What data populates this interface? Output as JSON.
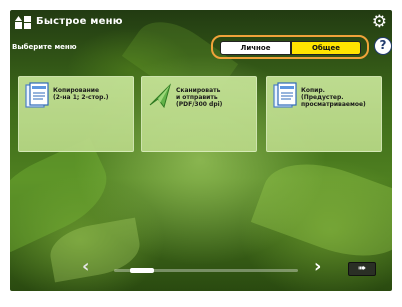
{
  "header": {
    "title": "Быстрое меню",
    "icons": {
      "home": "home-menu-icon",
      "settings": "gear-icon"
    }
  },
  "subtitle": "Выберите меню",
  "toggle": {
    "individual_label": "Личное",
    "common_label": "Общее",
    "selected": "common",
    "accent": "#ffe300",
    "frame": "#f0a33a"
  },
  "help": {
    "label": "?"
  },
  "tiles": [
    {
      "icon": "copy-icon",
      "label": "Копирование\n(2-на 1; 2-стор.)"
    },
    {
      "icon": "scan-send-icon",
      "label": "Сканировать\nи отправить\n(PDF/300 dpi)"
    },
    {
      "icon": "copy-icon",
      "label": "Копир.\n(Предустер.\nпросматриваемое)"
    }
  ],
  "pager": {
    "prev": "‹",
    "next": "›",
    "position": 0.1
  },
  "fast_button": {
    "label": "➠",
    "icon": "fast-forward-icon"
  }
}
